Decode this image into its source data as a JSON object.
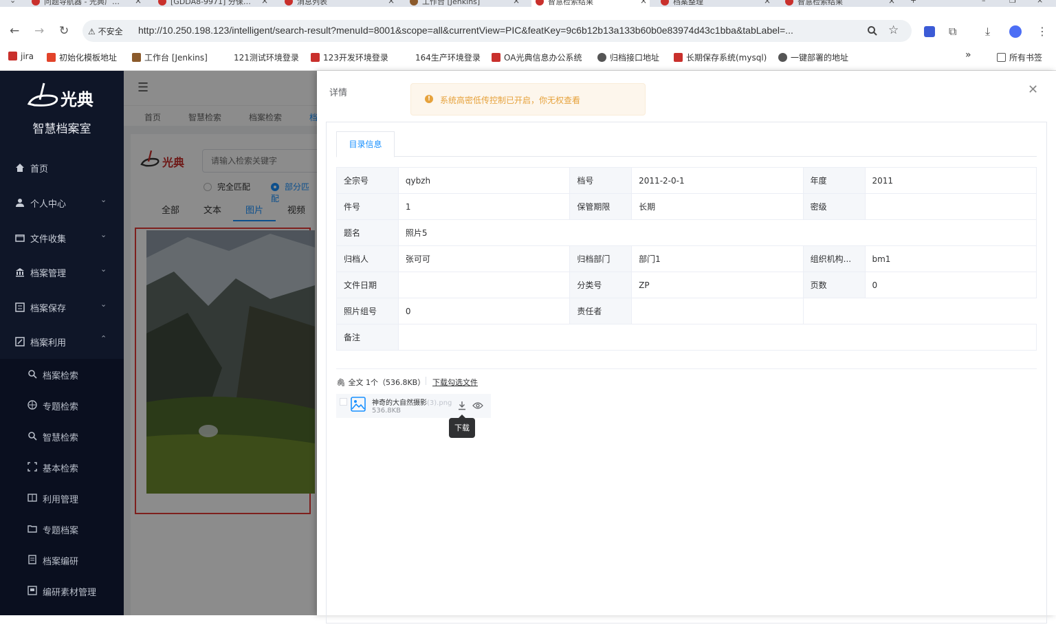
{
  "browser": {
    "tabs": [
      {
        "title": "问题导航器 - 光典广…",
        "active": false
      },
      {
        "title": "[GDDA8-9971] 分保…",
        "active": false
      },
      {
        "title": "消息列表",
        "active": false
      },
      {
        "title": "工作台 [Jenkins]",
        "active": false
      },
      {
        "title": "智慧检索结果",
        "active": true
      },
      {
        "title": "档案整理",
        "active": false
      },
      {
        "title": "智慧检索结果",
        "active": false
      }
    ],
    "insecure_label": "不安全",
    "url": "http://10.250.198.123/intelligent/search-result?menuId=8001&scope=all&currentView=PIC&featKey=9c6b12b13a133b60b0e83974d43c1bba&tabLabel=...",
    "bookmarks": [
      "jira",
      "初始化模板地址",
      "工作台 [Jenkins]",
      "121测试环境登录",
      "123开发环境登录",
      "164生产环境登录",
      "OA光典信息办公系统",
      "归档接口地址",
      "长期保存系统(mysql)",
      "一键部署的地址"
    ],
    "all_bookmarks": "所有书签",
    "overflow": "»"
  },
  "sidebar": {
    "logo_text": "光典",
    "system_name": "智慧档案室",
    "menu": [
      {
        "label": "首页",
        "icon": "home-icon",
        "arrow": ""
      },
      {
        "label": "个人中心",
        "icon": "user-icon",
        "arrow": "⌄"
      },
      {
        "label": "文件收集",
        "icon": "folder-icon",
        "arrow": "⌄"
      },
      {
        "label": "档案管理",
        "icon": "bank-icon",
        "arrow": "⌄"
      },
      {
        "label": "档案保存",
        "icon": "archive-icon",
        "arrow": "⌄"
      },
      {
        "label": "档案利用",
        "icon": "edit-icon",
        "arrow": "⌃"
      }
    ],
    "submenu": [
      {
        "label": "档案检索",
        "icon": "search-icon"
      },
      {
        "label": "专题检索",
        "icon": "compass-icon"
      },
      {
        "label": "智慧检索",
        "icon": "search-icon"
      },
      {
        "label": "基本检索",
        "icon": "scan-icon"
      },
      {
        "label": "利用管理",
        "icon": "book-icon"
      },
      {
        "label": "专题档案",
        "icon": "folder-open-icon"
      },
      {
        "label": "档案编研",
        "icon": "document-icon"
      },
      {
        "label": "编研素材管理",
        "icon": "material-icon"
      }
    ]
  },
  "content": {
    "breadcrumb_tabs": [
      "首页",
      "智慧检索",
      "档案检索",
      "档"
    ],
    "logo_text": "光典",
    "search_placeholder": "请输入检索关键字",
    "match_options": [
      "完全匹配",
      "部分匹配"
    ],
    "type_tabs": [
      "全部",
      "文本",
      "图片",
      "视频"
    ],
    "active_type": "图片"
  },
  "drawer": {
    "title": "详情",
    "warning": "系统高密低传控制已开启，你无权查看",
    "tab_label": "目录信息",
    "rows": [
      [
        {
          "k": "全宗号",
          "v": "qybzh"
        },
        {
          "k": "档号",
          "v": "2011-2-0-1"
        },
        {
          "k": "年度",
          "v": "2011"
        }
      ],
      [
        {
          "k": "件号",
          "v": "1"
        },
        {
          "k": "保管期限",
          "v": "长期"
        },
        {
          "k": "密级",
          "v": ""
        }
      ],
      [
        {
          "k": "题名",
          "v": "照片5"
        }
      ],
      [
        {
          "k": "归档人",
          "v": "张可可"
        },
        {
          "k": "归档部门",
          "v": "部门1"
        },
        {
          "k": "组织机构...",
          "v": "bm1"
        }
      ],
      [
        {
          "k": "文件日期",
          "v": ""
        },
        {
          "k": "分类号",
          "v": "ZP"
        },
        {
          "k": "页数",
          "v": "0"
        }
      ],
      [
        {
          "k": "照片组号",
          "v": "0"
        },
        {
          "k": "责任者",
          "v": ""
        }
      ],
      [
        {
          "k": "备注",
          "v": ""
        }
      ]
    ],
    "files_summary": "全文 1个（536.8KB）",
    "download_selected": "下载勾选文件",
    "file": {
      "name": "神奇的大自然摄影",
      "ext": "(3).png",
      "size": "536.8KB"
    },
    "tooltip": "下载"
  }
}
